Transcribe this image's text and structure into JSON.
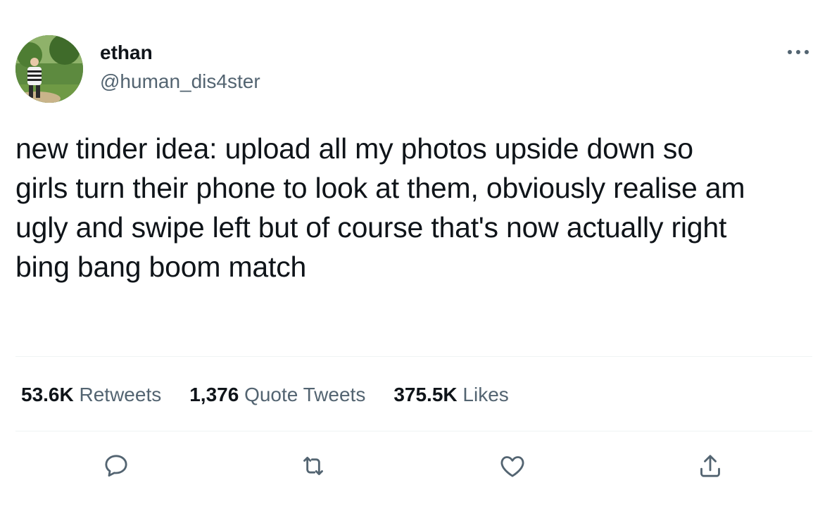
{
  "author": {
    "display_name": "ethan",
    "handle": "@human_dis4ster",
    "avatar_icon": "profile-photo"
  },
  "more_icon": "more-horizontal-icon",
  "tweet": {
    "lines": [
      "new tinder idea: upload all my photos upside down so",
      "girls turn their phone to look at them, obviously realise am",
      "ugly and swipe left but of course that's now actually right",
      "bing bang boom match"
    ]
  },
  "stats": {
    "retweets": {
      "count": "53.6K",
      "label": "Retweets"
    },
    "quote_tweets": {
      "count": "1,376",
      "label": "Quote Tweets"
    },
    "likes": {
      "count": "375.5K",
      "label": "Likes"
    }
  },
  "actions": {
    "reply_icon": "reply-icon",
    "retweet_icon": "retweet-icon",
    "like_icon": "heart-icon",
    "share_icon": "share-icon"
  },
  "colors": {
    "primary_text": "#0f1419",
    "secondary_text": "#536471",
    "divider": "#eff3f4"
  }
}
